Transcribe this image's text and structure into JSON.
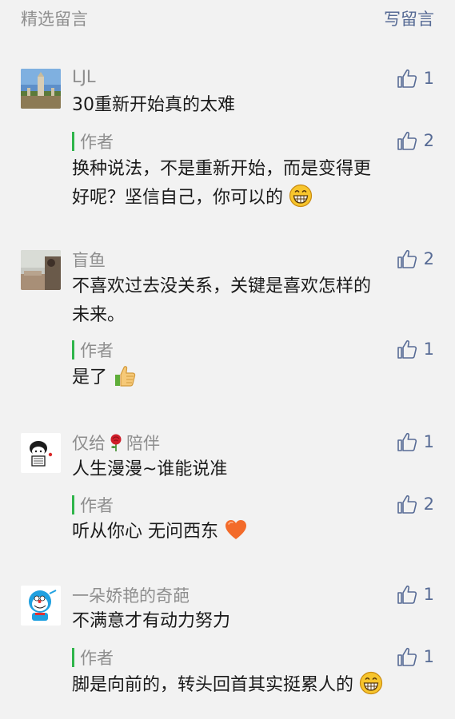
{
  "header": {
    "title": "精选留言",
    "write_label": "写留言"
  },
  "comments": [
    {
      "name": "LJL",
      "likes": "1",
      "text": "30重新开始真的太难",
      "reply": {
        "author": "作者",
        "likes": "2",
        "line1": "换种说法，不是重新开始，而是变得更",
        "line2": "好呢？坚信自己，你可以的"
      }
    },
    {
      "name": "盲鱼",
      "likes": "2",
      "line1": "不喜欢过去没关系，关键是喜欢怎样的",
      "line2": "未来。",
      "reply": {
        "author": "作者",
        "likes": "1",
        "text": "是了"
      }
    },
    {
      "name_part1": "仅给",
      "name_part2": "陪伴",
      "likes": "1",
      "text": "人生漫漫~谁能说准",
      "reply": {
        "author": "作者",
        "likes": "2",
        "text": "听从你心 无问西东"
      }
    },
    {
      "name": "一朵娇艳的奇葩",
      "likes": "1",
      "text": "不满意才有动力努力",
      "reply": {
        "author": "作者",
        "likes": "1",
        "text": "脚是向前的，转头回首其实挺累人的"
      }
    }
  ],
  "icons": {
    "like": "thumbs-up-icon",
    "grin": "grinning-face-icon",
    "thumb_emoji": "thumbs-up-emoji-icon",
    "heart": "orange-heart-icon",
    "rose": "rose-icon"
  },
  "colors": {
    "accent": "#576b95",
    "reply_bar": "#2fb54a",
    "muted": "#8e8e8e",
    "background": "#f2f2f2"
  }
}
